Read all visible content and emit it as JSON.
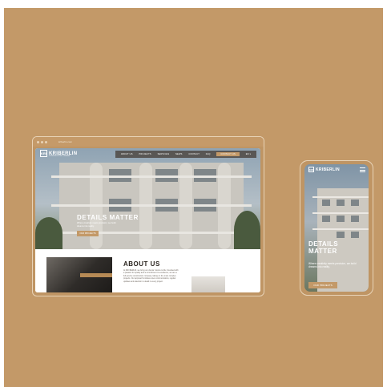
{
  "desktop": {
    "url": "kriberlin.com",
    "brand": {
      "mark": "KRI",
      "name": "KRIBERLIN",
      "tagline": "CONSTRUCTION COMPANY"
    },
    "nav": [
      "ABOUT US",
      "PROJECTS",
      "SERVICES",
      "NEWS",
      "CONTACT",
      "FAQ"
    ],
    "nav_button": "CONTACT US",
    "language": "EN ▾",
    "hero": {
      "title": "DETAILS MATTER",
      "subtitle": "Where creativity meets precision, we build dreams into reality.",
      "button": "OUR PROJECTS"
    },
    "about": {
      "title": "ABOUT US",
      "text": "At KRI BERLIN, we bring our clients' visions to life. Founded with a passion for quality and a commitment to excellence, we are a full-service construction company, taking on the most complex projects. Our approach includes open communication, regular updates and attention to detail in every project."
    }
  },
  "mobile": {
    "brand": {
      "mark": "KRI",
      "name": "KRIBERLIN"
    },
    "hero": {
      "title": "DETAILS MATTER",
      "subtitle": "Where creativity meets precision, we build dreams into reality.",
      "button": "OUR PROJECTS"
    }
  },
  "colors": {
    "background": "#c39968",
    "accent": "#c39968",
    "nav": "#463c34"
  },
  "icons": [
    "menu-icon"
  ]
}
